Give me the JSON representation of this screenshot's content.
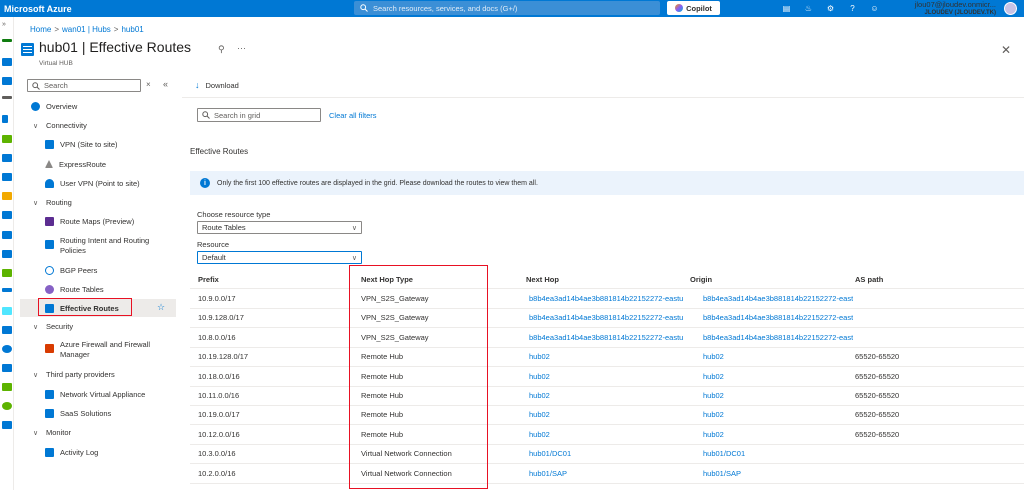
{
  "topbar": {
    "brand": "Microsoft Azure",
    "search_placeholder": "Search resources, services, and docs (G+/)",
    "copilot": "Copilot",
    "account_email": "jlou07@jloudev.onmicr...",
    "account_tenant": "JLOUDEV (JLOUDEV.TK)"
  },
  "breadcrumb": [
    "Home",
    "wan01 | Hubs",
    "hub01"
  ],
  "page": {
    "title": "hub01 | Effective Routes",
    "subtitle": "Virtual HUB"
  },
  "sidebar": {
    "search_placeholder": "Search",
    "items": [
      {
        "label": "Overview",
        "type": "item",
        "icon": "overview-icon",
        "color": "#0078d4"
      },
      {
        "label": "Connectivity",
        "type": "group"
      },
      {
        "label": "VPN (Site to site)",
        "type": "item",
        "icon": "vpn-icon",
        "color": "#0078d4"
      },
      {
        "label": "ExpressRoute",
        "type": "item",
        "icon": "expressroute-icon",
        "color": "#8a8886"
      },
      {
        "label": "User VPN (Point to site)",
        "type": "item",
        "icon": "user-vpn-icon",
        "color": "#0078d4"
      },
      {
        "label": "Routing",
        "type": "group"
      },
      {
        "label": "Route Maps (Preview)",
        "type": "item",
        "icon": "route-maps-icon",
        "color": "#5c2d91"
      },
      {
        "label": "Routing Intent and Routing Policies",
        "type": "item",
        "icon": "routing-intent-icon",
        "color": "#0078d4"
      },
      {
        "label": "BGP Peers",
        "type": "item",
        "icon": "bgp-peers-icon",
        "color": "#0078d4"
      },
      {
        "label": "Route Tables",
        "type": "item",
        "icon": "route-tables-icon",
        "color": "#8661c5"
      },
      {
        "label": "Effective Routes",
        "type": "item",
        "icon": "effective-routes-icon",
        "color": "#0078d4"
      },
      {
        "label": "Security",
        "type": "group"
      },
      {
        "label": "Azure Firewall and Firewall Manager",
        "type": "item",
        "icon": "firewall-icon",
        "color": "#d83b01"
      },
      {
        "label": "Third party providers",
        "type": "group"
      },
      {
        "label": "Network Virtual Appliance",
        "type": "item",
        "icon": "nva-icon",
        "color": "#0078d4"
      },
      {
        "label": "SaaS Solutions",
        "type": "item",
        "icon": "saas-icon",
        "color": "#0078d4"
      },
      {
        "label": "Monitor",
        "type": "group"
      },
      {
        "label": "Activity Log",
        "type": "item",
        "icon": "activity-log-icon",
        "color": "#0078d4"
      }
    ]
  },
  "toolbar": {
    "download": "Download"
  },
  "grid": {
    "search_placeholder": "Search in grid",
    "clear_filters": "Clear all filters",
    "section_title": "Effective Routes",
    "info": "Only the first 100 effective routes are displayed in the grid. Please download the routes to view them all.",
    "resource_type_label": "Choose resource type",
    "resource_type_value": "Route Tables",
    "resource_label": "Resource",
    "resource_value": "Default",
    "columns": [
      "Prefix",
      "Next Hop Type",
      "Next Hop",
      "Origin",
      "AS path"
    ],
    "rows": [
      [
        "10.9.0.0/17",
        "VPN_S2S_Gateway",
        "b8b4ea3ad14b4ae3b881814b22152272-eastu",
        "b8b4ea3ad14b4ae3b881814b22152272-eastu",
        ""
      ],
      [
        "10.9.128.0/17",
        "VPN_S2S_Gateway",
        "b8b4ea3ad14b4ae3b881814b22152272-eastu",
        "b8b4ea3ad14b4ae3b881814b22152272-eastu",
        ""
      ],
      [
        "10.8.0.0/16",
        "VPN_S2S_Gateway",
        "b8b4ea3ad14b4ae3b881814b22152272-eastu",
        "b8b4ea3ad14b4ae3b881814b22152272-eastu",
        ""
      ],
      [
        "10.19.128.0/17",
        "Remote Hub",
        "hub02",
        "hub02",
        "65520-65520"
      ],
      [
        "10.18.0.0/16",
        "Remote Hub",
        "hub02",
        "hub02",
        "65520-65520"
      ],
      [
        "10.11.0.0/16",
        "Remote Hub",
        "hub02",
        "hub02",
        "65520-65520"
      ],
      [
        "10.19.0.0/17",
        "Remote Hub",
        "hub02",
        "hub02",
        "65520-65520"
      ],
      [
        "10.12.0.0/16",
        "Remote Hub",
        "hub02",
        "hub02",
        "65520-65520"
      ],
      [
        "10.3.0.0/16",
        "Virtual Network Connection",
        "hub01/DC01",
        "hub01/DC01",
        ""
      ],
      [
        "10.2.0.0/16",
        "Virtual Network Connection",
        "hub01/SAP",
        "hub01/SAP",
        ""
      ]
    ]
  },
  "colors": {
    "brand": "#0078d4",
    "highlight_border": "#e81123",
    "selected_bg": "#edebe9"
  }
}
